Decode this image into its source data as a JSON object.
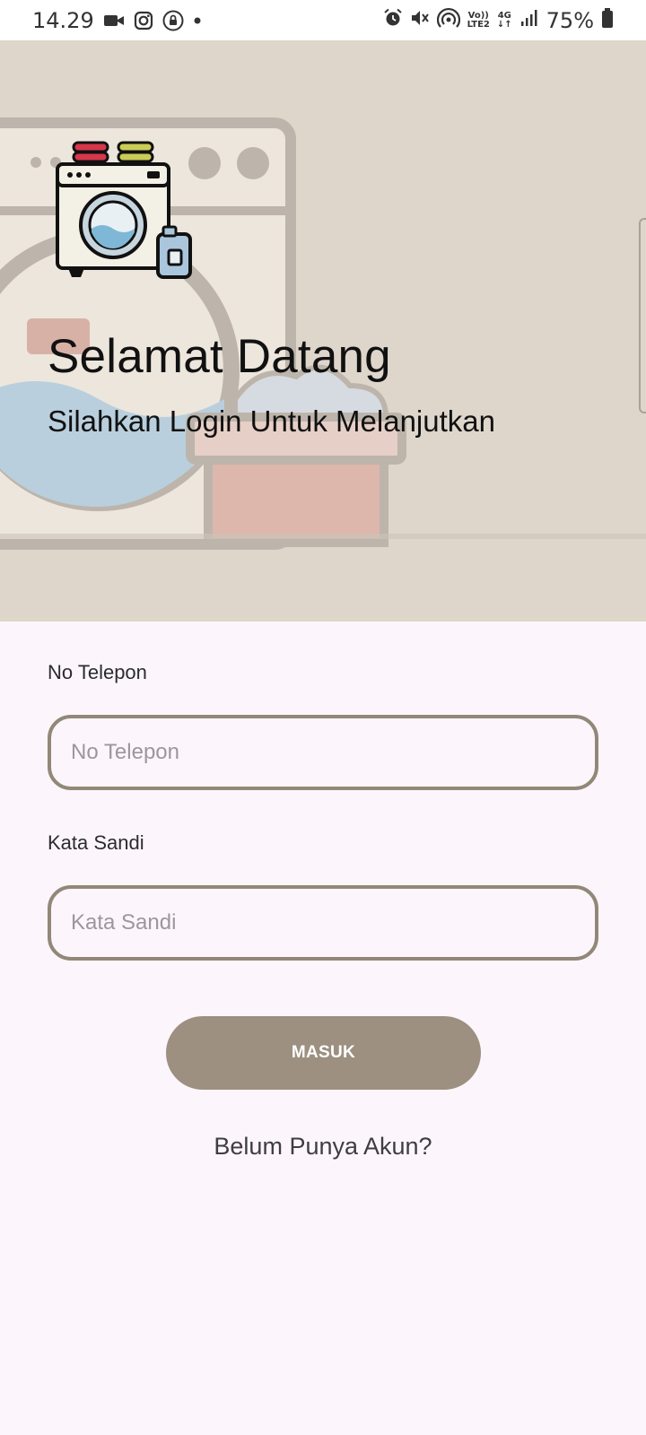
{
  "status_bar": {
    "time": "14.29",
    "battery": "75%",
    "network_top": "Vo))",
    "network_bottom": "LTE2",
    "gen_top": "4G",
    "gen_bottom": "↓↑",
    "icons_left": [
      "video-icon",
      "instagram-icon",
      "lock-icon",
      "dot-icon"
    ],
    "icons_right": [
      "alarm-icon",
      "mute-icon",
      "hotspot-icon",
      "signal-icon",
      "battery-icon"
    ]
  },
  "hero": {
    "title": "Selamat Datang",
    "subtitle": "Silahkan Login Untuk Melanjutkan",
    "logo_icon": "washing-machine-icon"
  },
  "form": {
    "phone_label": "No Telepon",
    "phone_placeholder": "No Telepon",
    "phone_value": "",
    "password_label": "Kata Sandi",
    "password_placeholder": "Kata Sandi",
    "password_value": "",
    "submit_label": "MASUK",
    "register_link": "Belum Punya Akun?"
  },
  "colors": {
    "hero_bg": "#ded6cb",
    "page_bg": "#fcf6fc",
    "accent": "#9d9080",
    "field_border": "#928878"
  }
}
